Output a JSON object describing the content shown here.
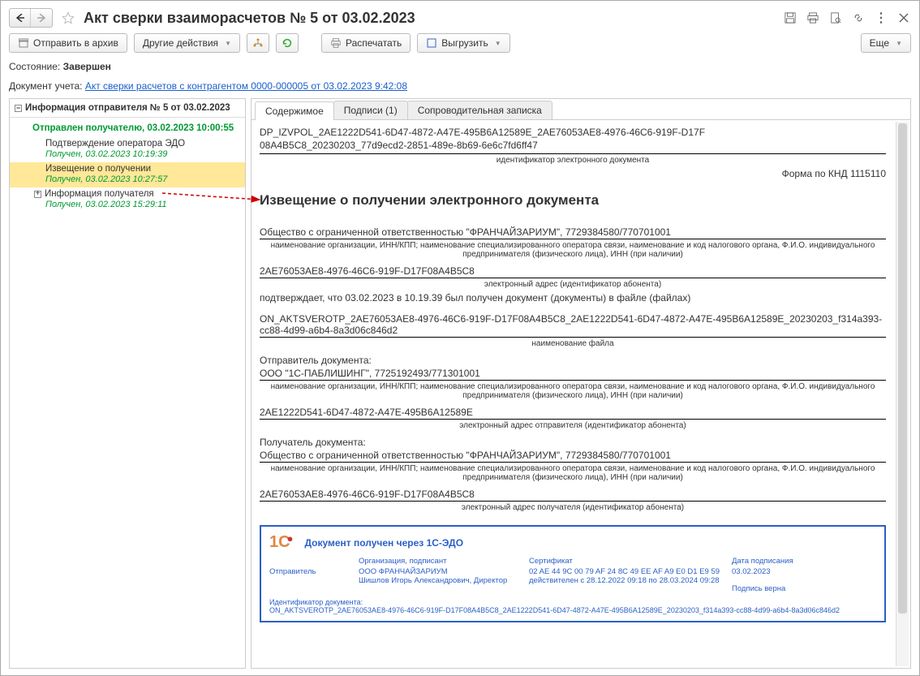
{
  "title": "Акт сверки взаиморасчетов № 5 от 03.02.2023",
  "toolbar": {
    "send_archive": "Отправить в архив",
    "other_actions": "Другие действия",
    "print": "Распечатать",
    "export": "Выгрузить",
    "more": "Еще"
  },
  "status": {
    "label": "Состояние:",
    "value": "Завершен"
  },
  "doc_ref": {
    "label": "Документ учета:",
    "link": "Акт сверки расчетов с контрагентом 0000-000005 от 03.02.2023 9:42:08"
  },
  "sidebar": {
    "header": "Информация отправителя № 5 от 03.02.2023",
    "sent": "Отправлен получателю, 03.02.2023 10:00:55",
    "items": [
      {
        "label": "Подтверждение оператора ЭДО",
        "sub": "Получен, 03.02.2023 10:19:39",
        "highlight": false,
        "parent": false
      },
      {
        "label": "Извещение о получении",
        "sub": "Получен, 03.02.2023 10:27:57",
        "highlight": true,
        "parent": false
      },
      {
        "label": "Информация получателя",
        "sub": "Получен, 03.02.2023 15:29:11",
        "highlight": false,
        "parent": true
      }
    ]
  },
  "tabs": [
    {
      "label": "Содержимое",
      "active": true
    },
    {
      "label": "Подписи (1)",
      "active": false
    },
    {
      "label": "Сопроводительная записка",
      "active": false
    }
  ],
  "content": {
    "file_id_line1": "DP_IZVPOL_2AE1222D541-6D47-4872-A47E-495B6A12589E_2AE76053AE8-4976-46C6-919F-D17F",
    "file_id_line2": "08A4B5C8_20230203_77d9ecd2-2851-489e-8b69-6e6c7fd6ff47",
    "file_id_desc": "идентификатор электронного документа",
    "form_code": "Форма по КНД 1115110",
    "doc_title": "Извещение о получении электронного документа",
    "org1": "Общество с ограниченной ответственностью \"ФРАНЧАЙЗАРИУМ\", 7729384580/770701001",
    "org_desc": "наименование организации, ИНН/КПП; наименование специализированного оператора связи, наименование и код налогового органа, Ф.И.О. индивидуального предпринимателя (физического лица), ИНН (при наличии)",
    "addr1": "2AE76053AE8-4976-46C6-919F-D17F08A4B5C8",
    "addr1_desc": "электронный адрес (идентификатор абонента)",
    "confirm": "подтверждает, что 03.02.2023 в 10.19.39 был получен документ (документы) в файле (файлах)",
    "file_name": "ON_AKTSVEROTP_2AE76053AE8-4976-46C6-919F-D17F08A4B5C8_2AE1222D541-6D47-4872-A47E-495B6A12589E_20230203_f314a393-cc88-4d99-a6b4-8a3d06c846d2",
    "file_name_desc": "наименование файла",
    "sender_label": "Отправитель документа:",
    "sender_org": "ООО \"1С-ПАБЛИШИНГ\", 7725192493/771301001",
    "sender_addr": "2AE1222D541-6D47-4872-A47E-495B6A12589E",
    "sender_addr_desc": "электронный адрес отправителя (идентификатор абонента)",
    "recipient_label": "Получатель документа:",
    "recipient_org": "Общество с ограниченной ответственностью \"ФРАНЧАЙЗАРИУМ\", 7729384580/770701001",
    "recipient_addr": "2AE76053AE8-4976-46C6-919F-D17F08A4B5C8",
    "recipient_addr_desc": "электронный адрес получателя (идентификатор абонента)"
  },
  "stamp": {
    "title": "Документ получен через 1С-ЭДО",
    "sender_lbl": "Отправитель",
    "org_lbl": "Организация, подписант",
    "org_val1": "ООО ФРАНЧАЙЗАРИУМ",
    "org_val2": "Шишлов Игорь Александрович, Директор",
    "cert_lbl": "Сертификат",
    "cert_val1": "02 AE 44 9C 00 79 AF 24 8C 49 EE AF A9 E0 D1 E9 59",
    "cert_val2": "действителен с 28.12.2022 09:18 по 28.03.2024 09:28",
    "date_lbl": "Дата подписания",
    "date_val": "03.02.2023",
    "sig_valid": "Подпись верна",
    "id_lbl": "Идентификатор документа:",
    "id_val": "ON_AKTSVEROTP_2AE76053AE8-4976-46C6-919F-D17F08A4B5C8_2AE1222D541-6D47-4872-A47E-495B6A12589E_20230203_f314a393-cc88-4d99-a6b4-8a3d06c846d2"
  }
}
